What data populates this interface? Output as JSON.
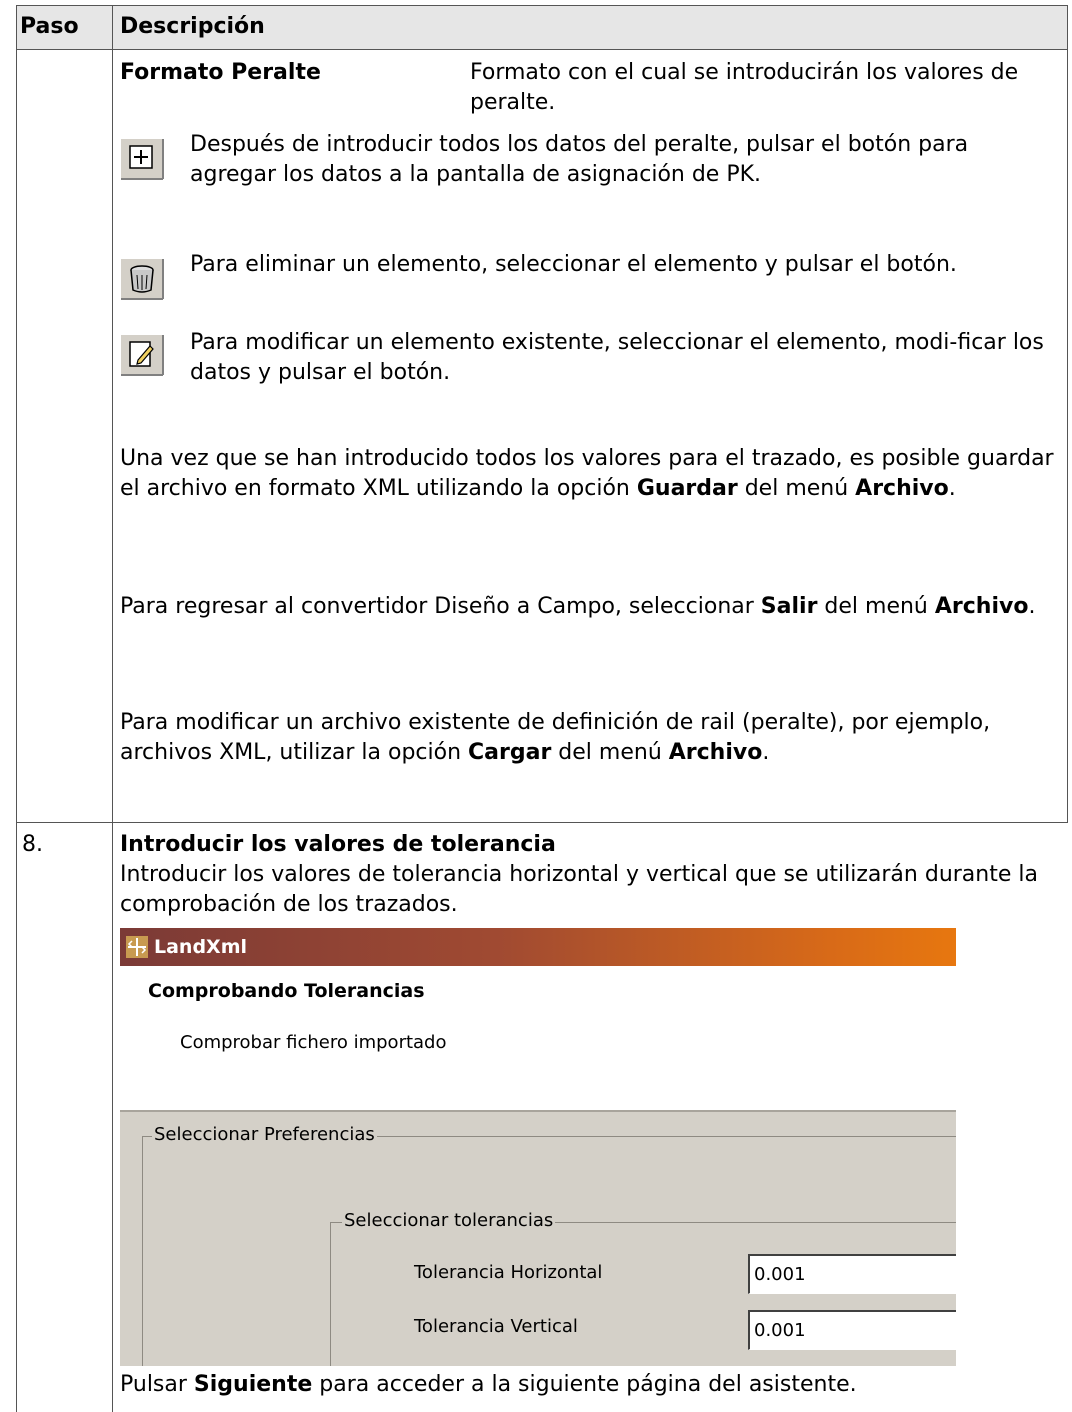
{
  "table": {
    "col_step": "Paso",
    "col_description": "Descripción"
  },
  "format_row": {
    "label": "Formato Peralte",
    "description": "Formato con el cual se introducirán los valores de peralte."
  },
  "icon_items": [
    {
      "icon": "add-icon",
      "text": "Después de introducir todos los datos del peralte, pulsar el botón para agregar los datos a la pantalla de asignación de PK."
    },
    {
      "icon": "trash-icon",
      "text": "Para eliminar un elemento, seleccionar el elemento y pulsar el botón."
    },
    {
      "icon": "edit-icon",
      "text": "Para modificar un elemento existente, seleccionar el elemento, modi-ficar los datos y pulsar el botón."
    }
  ],
  "paragraphs": {
    "save": {
      "before": "Una vez que se han introducido todos los valores para el trazado, es posible guardar el archivo en formato XML utilizando la opción ",
      "bold1": "Guardar",
      "middle": " del menú ",
      "bold2": "Archivo",
      "after": "."
    },
    "exit": {
      "before": "Para regresar al convertidor Diseño a Campo, seleccionar ",
      "bold1": "Salir",
      "middle": " del menú ",
      "bold2": "Archivo",
      "after": "."
    },
    "load": {
      "before": "Para modificar un archivo existente de definición de rail (peralte), por ejemplo, archivos XML, utilizar la opción ",
      "bold1": "Cargar",
      "middle": " del menú ",
      "bold2": "Archivo",
      "after": "."
    }
  },
  "step8": {
    "number": "8.",
    "heading": "Introducir los valores de tolerancia",
    "text": "Introducir los valores de tolerancia horizontal y vertical que se utilizarán durante la comprobación de los trazados.",
    "footer_before": "Pulsar ",
    "footer_bold": "Siguiente",
    "footer_after": " para acceder a la siguiente página del asistente."
  },
  "dialog": {
    "window_title": "LandXml",
    "page_title": "Comprobando Tolerancias",
    "page_subtitle": "Comprobar fichero importado",
    "group_outer": "Seleccionar Preferencias",
    "group_inner": "Seleccionar tolerancias",
    "horizontal_label": "Tolerancia Horizontal",
    "horizontal_value": "0.001",
    "vertical_label": "Tolerancia Vertical",
    "vertical_value": "0.001"
  }
}
